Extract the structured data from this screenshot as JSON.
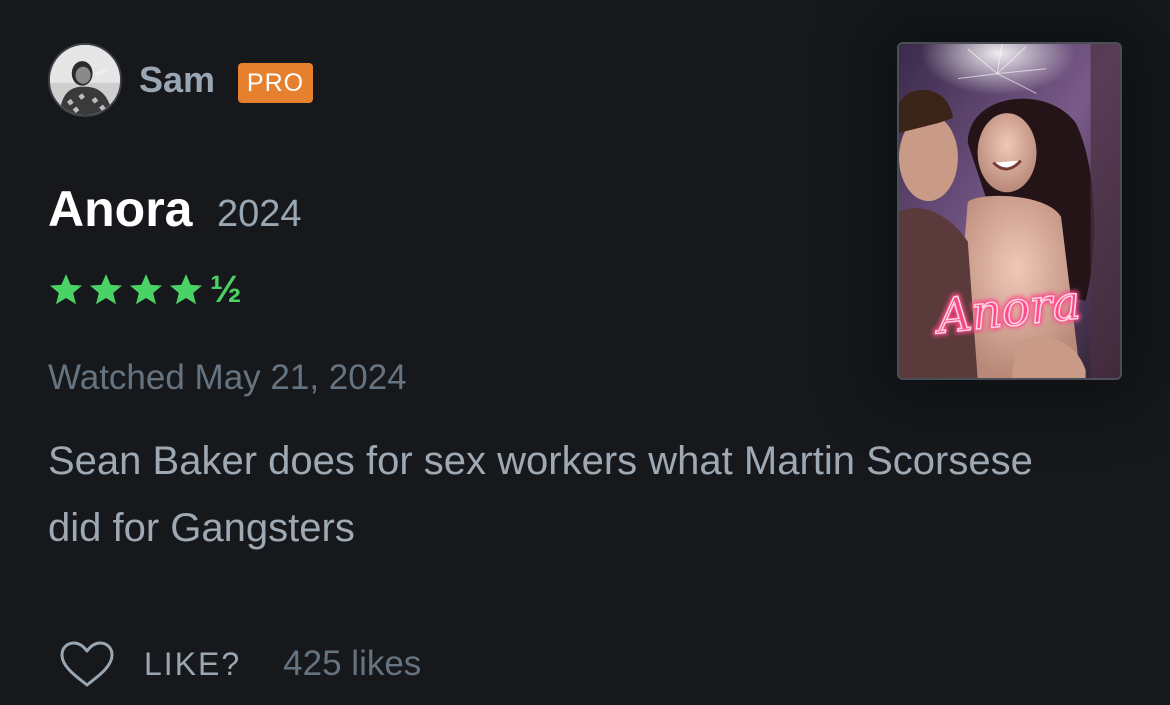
{
  "user": {
    "name": "Sam",
    "badge": "PRO"
  },
  "film": {
    "title": "Anora",
    "year": "2024",
    "poster_text": "Anora"
  },
  "rating": {
    "stars": 4.5,
    "max": 5,
    "half_symbol": "½",
    "color": "#4bd264"
  },
  "watched_text": "Watched May 21, 2024",
  "review_text": "Sean Baker does for sex workers what Martin Scorsese did for Gangsters",
  "actions": {
    "like_label": "LIKE?",
    "likes_count": "425 likes"
  },
  "colors": {
    "background": "#16181c",
    "pro_badge": "#e5802f",
    "muted_text": "#9aa7b3",
    "dim_text": "#667481"
  }
}
